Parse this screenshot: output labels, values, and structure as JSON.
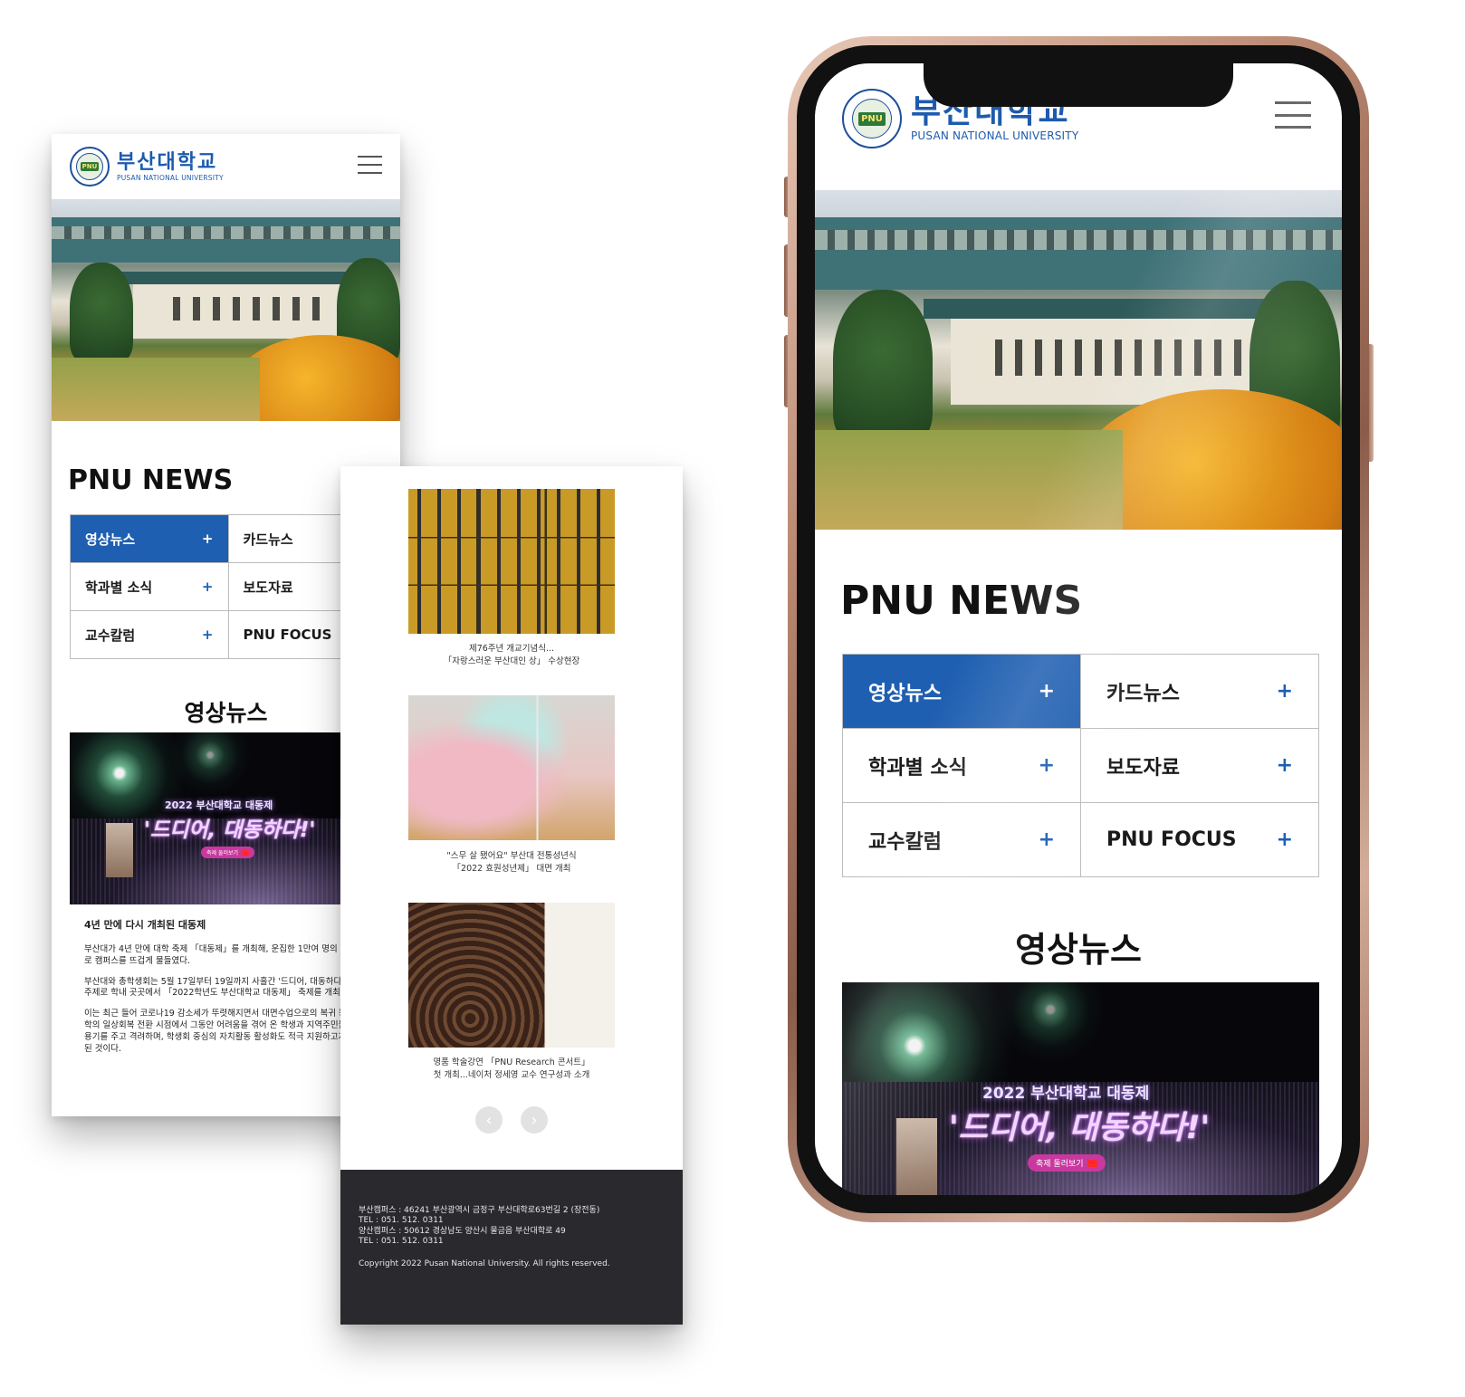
{
  "brand": {
    "name_ko": "부산대학교",
    "name_en": "PUSAN NATIONAL UNIVERSITY",
    "emblem_mark": "PNU",
    "primary_color": "#1f5fb1"
  },
  "news": {
    "title": "PNU NEWS",
    "categories": [
      {
        "label": "영상뉴스"
      },
      {
        "label": "카드뉴스"
      },
      {
        "label": "학과별 소식"
      },
      {
        "label": "보도자료"
      },
      {
        "label": "교수칼럼"
      },
      {
        "label": "PNU FOCUS"
      }
    ],
    "plus": "+"
  },
  "video_news": {
    "title": "영상뉴스",
    "banner": {
      "year_line": "2022 부산대학교 대동제",
      "slogan": "'드디어, 대동하다!'",
      "badge": "축제 둘러보기"
    },
    "article": {
      "headline": "4년 만에 다시 개최된 대동제",
      "paragraphs": [
        "부산대가 4년 만에 대학 축제 「대동제」를 개최해, 운집한 1만여 명의 함성으로 캠퍼스를 뜨겁게 물들였다.",
        "부산대와 총학생회는 5월 17일부터 19일까지 사흘간 '드디어, 대동하다!'라는 주제로 학내 곳곳에서 「2022학년도 부산대학교 대동제」 축제를 개최했다.",
        "이는 최근 들어 코로나19 감소세가 뚜렷해지면서 대면수업으로의 복귀 등 대학의 일상회복 전환 시점에서 그동안 어려움을 겪어 온 학생과 지역주민들에게 용기를 주고 격려하며, 학생회 중심의 자치활동 활성화도 적극 지원하고자 추진된 것이다."
      ]
    }
  },
  "card_list": [
    {
      "line1": "제76주년 개교기념식...",
      "line2": "「자랑스러운 부산대인 상」 수상현장"
    },
    {
      "line1": "\"스무 살 됐어요\" 부산대 전통성년식",
      "line2": "「2022 효원성년제」 대면 개최"
    },
    {
      "line1": "명품 학술강연 「PNU Research 콘서트」",
      "line2": "첫 개최...네이처 정세영 교수 연구성과 소개"
    }
  ],
  "pager": {
    "prev": "‹",
    "next": "›"
  },
  "footer": {
    "line1": "부산캠퍼스 : 46241 부산광역시 금정구 부산대학로63번길 2 (장전동)",
    "line2": "TEL : 051. 512. 0311",
    "line3": "양산캠퍼스 : 50612 경상남도 양산시 물금읍 부산대학로 49",
    "line4": "TEL : 051. 512. 0311",
    "copyright": "Copyright 2022 Pusan National University. All rights reserved."
  },
  "icons": [
    "hamburger-menu-icon",
    "plus-icon",
    "prev-arrow-icon",
    "next-arrow-icon",
    "youtube-icon",
    "university-emblem-icon"
  ]
}
